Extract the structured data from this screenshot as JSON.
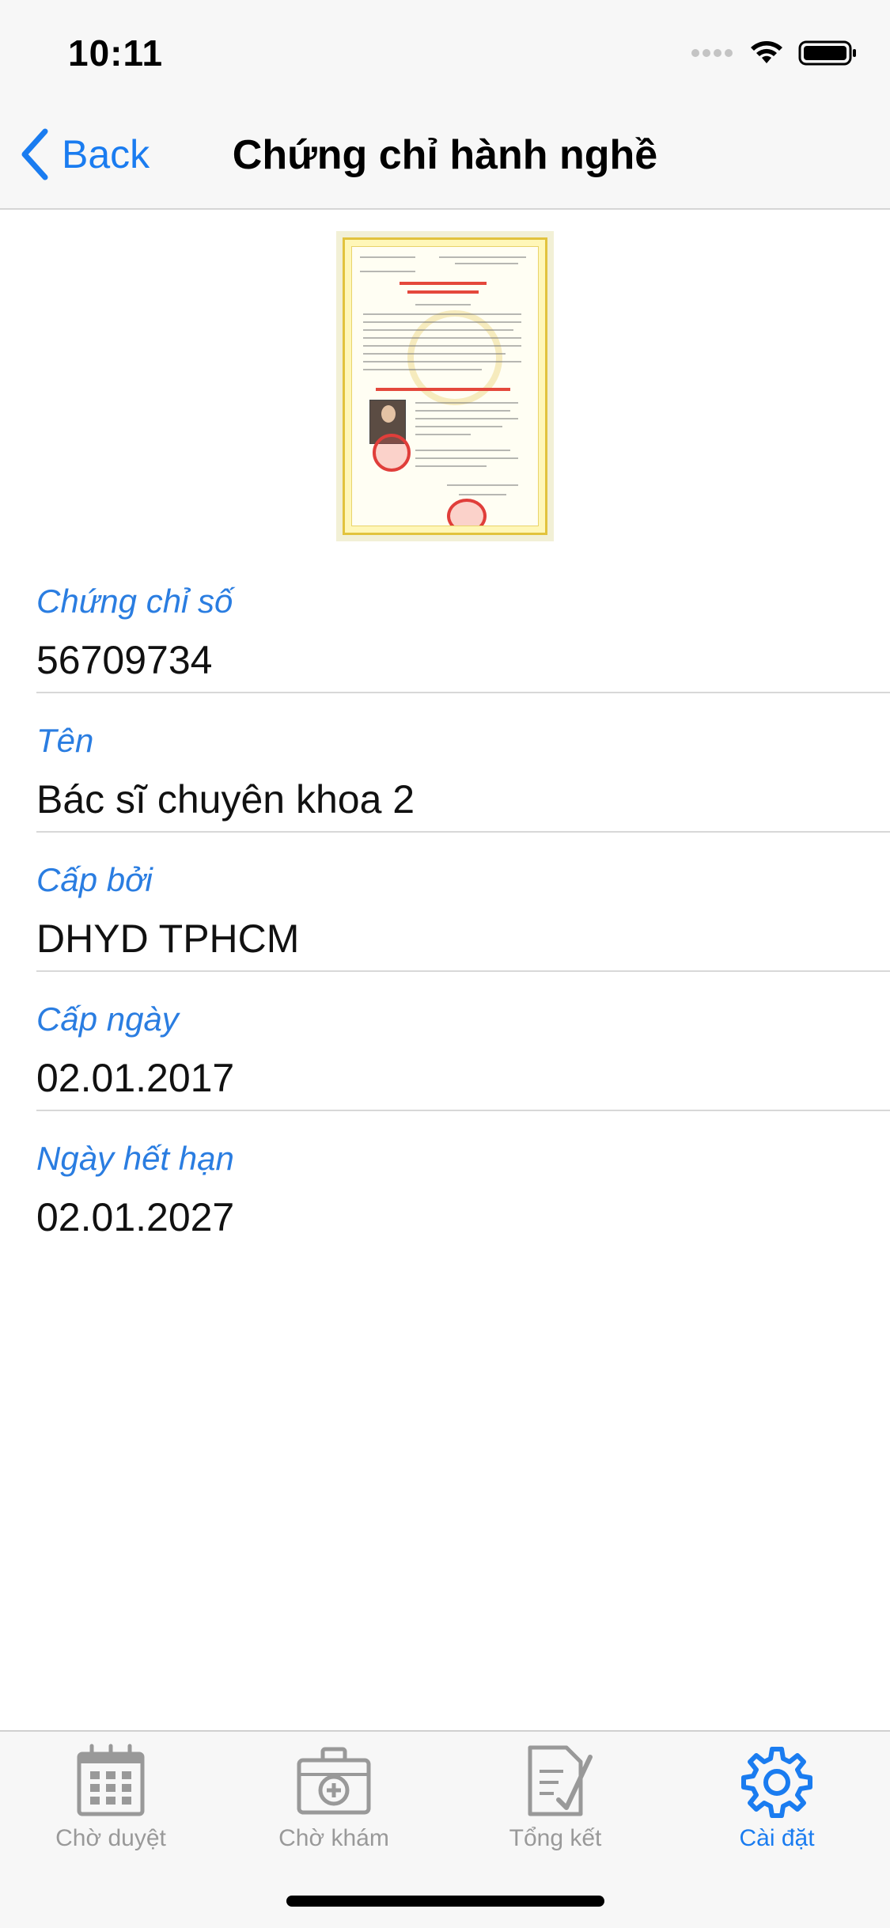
{
  "status_bar": {
    "time": "10:11"
  },
  "nav": {
    "back_label": "Back",
    "title": "Chứng chỉ hành nghề"
  },
  "fields": [
    {
      "label": "Chứng chỉ số",
      "value": "56709734"
    },
    {
      "label": "Tên",
      "value": "Bác sĩ chuyên khoa 2"
    },
    {
      "label": "Cấp bởi",
      "value": "DHYD TPHCM"
    },
    {
      "label": "Cấp ngày",
      "value": "02.01.2017"
    },
    {
      "label": "Ngày hết hạn",
      "value": "02.01.2027"
    }
  ],
  "tabs": [
    {
      "label": "Chờ duyệt",
      "icon": "calendar-icon",
      "active": false
    },
    {
      "label": "Chờ khám",
      "icon": "medical-kit-icon",
      "active": false
    },
    {
      "label": "Tổng kết",
      "icon": "checklist-icon",
      "active": false
    },
    {
      "label": "Cài đặt",
      "icon": "gear-icon",
      "active": true
    }
  ],
  "colors": {
    "accent": "#1a7cf0",
    "label": "#2a7de1",
    "inactive_tab": "#999999"
  }
}
